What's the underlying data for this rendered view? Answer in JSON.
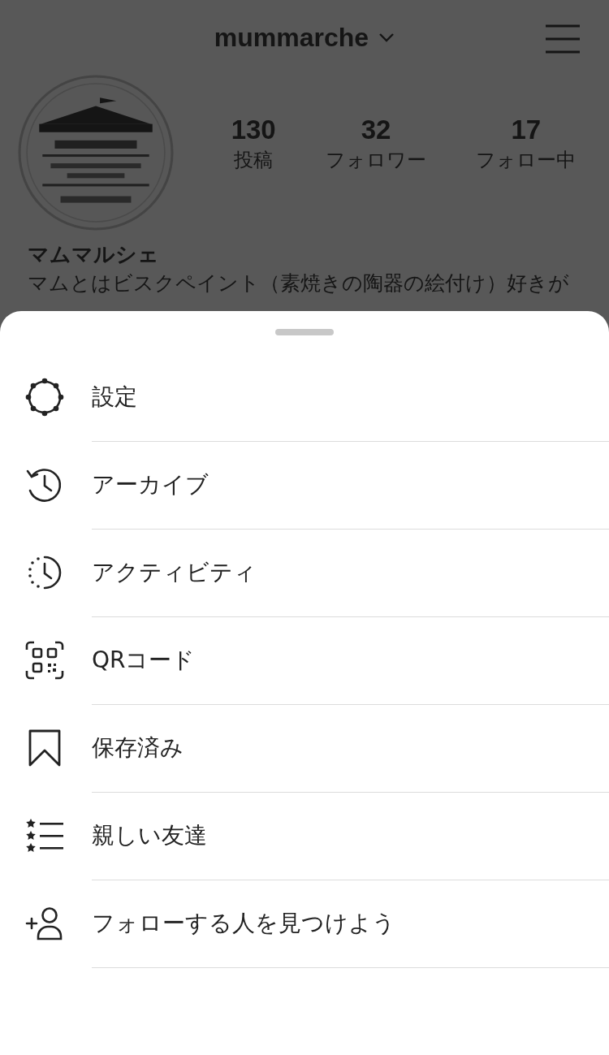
{
  "header": {
    "username": "mummarche"
  },
  "profile": {
    "stats": [
      {
        "value": "130",
        "label": "投稿"
      },
      {
        "value": "32",
        "label": "フォロワー"
      },
      {
        "value": "17",
        "label": "フォロー中"
      }
    ],
    "name": "マムマルシェ",
    "bio": "マムとはビスクペイント（素焼きの陶器の絵付け）好きが"
  },
  "menu": [
    {
      "kind": "gear",
      "label": "設定"
    },
    {
      "kind": "archive",
      "label": "アーカイブ"
    },
    {
      "kind": "activity",
      "label": "アクティビティ"
    },
    {
      "kind": "qr",
      "label": "QRコード"
    },
    {
      "kind": "bookmark",
      "label": "保存済み"
    },
    {
      "kind": "friends",
      "label": "親しい友達"
    },
    {
      "kind": "addperson",
      "label": "フォローする人を見つけよう"
    }
  ]
}
